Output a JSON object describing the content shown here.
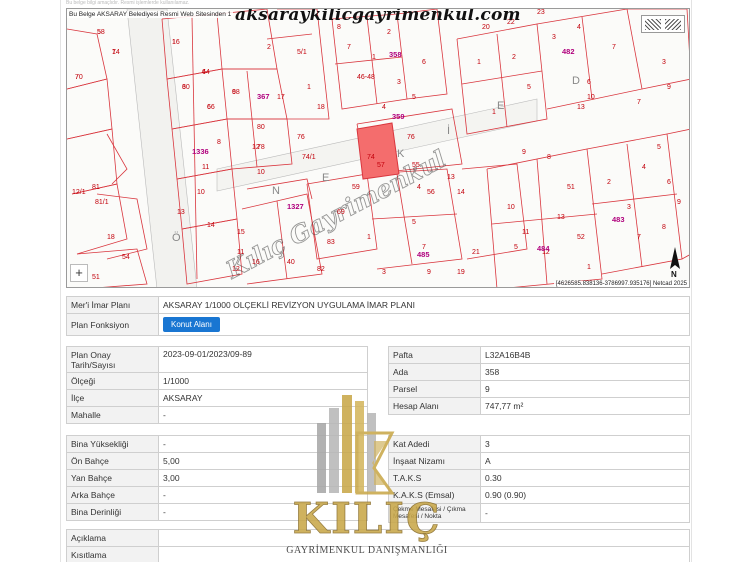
{
  "page": {
    "top_note": "Bu belge bilgi amaçlıdır. Resmi işlemlerde kullanılamaz."
  },
  "map": {
    "source_text": "Bu Belge AKSARAY Belediyesi Resmi Web Sitesinden 1",
    "watermark_url": "aksaraykilicgayrimenkul.com",
    "coords_text": "[4626585.838136-3786997.935176] Netcad 2025",
    "zoom_in_symbol": "+",
    "north_label": "N",
    "street_letters": [
      "Ö",
      "N",
      "E",
      "K",
      "İ",
      "E",
      "D"
    ],
    "diagonal_watermark": "Kılıç Gayrimenkul",
    "highlight_color": "#f46d6d",
    "block_numbers": [
      "367",
      "1336",
      "358",
      "1327",
      "483",
      "484",
      "485",
      "482",
      "359"
    ],
    "parcel_numbers": [
      "7",
      "5",
      "7",
      "1",
      "3",
      "4",
      "6",
      "9",
      "8",
      "11",
      "12",
      "10",
      "13",
      "14",
      "15",
      "16",
      "2",
      "5/1",
      "1",
      "17",
      "18",
      "80",
      "76",
      "78",
      "74/1",
      "74",
      "76",
      "57",
      "55",
      "56",
      "13",
      "14",
      "12/1",
      "81",
      "81/1",
      "18",
      "54",
      "51",
      "46-48",
      "1",
      "2",
      "3",
      "4",
      "5",
      "6",
      "7",
      "8",
      "10",
      "11",
      "12",
      "40",
      "82",
      "83",
      "69",
      "59",
      "1",
      "3",
      "4",
      "5",
      "7",
      "9",
      "19",
      "21",
      "20",
      "22",
      "23",
      "1",
      "2",
      "3",
      "4",
      "5",
      "6",
      "7",
      "8",
      "9",
      "10",
      "11",
      "12",
      "13",
      "51",
      "52",
      "1",
      "2",
      "3",
      "4",
      "5",
      "6",
      "7",
      "8",
      "9",
      "1",
      "3",
      "5",
      "7",
      "9",
      "10",
      "13",
      "70",
      "58",
      "14",
      "16",
      "60",
      "64",
      "66",
      "68"
    ]
  },
  "fields": {
    "meri_imar_plani": {
      "label": "Mer'i İmar Planı",
      "value": "AKSARAY 1/1000 OLÇEKLİ REVİZYON UYGULAMA İMAR PLANI"
    },
    "plan_fonksiyon": {
      "label": "Plan Fonksiyon",
      "button": "Konut Alanı"
    },
    "plan_onay": {
      "label": "Plan Onay Tarih/Sayısı",
      "value": "2023-09-01/2023/09-89"
    },
    "olcegi": {
      "label": "Ölçeği",
      "value": "1/1000"
    },
    "ilce": {
      "label": "İlçe",
      "value": "AKSARAY"
    },
    "mahalle": {
      "label": "Mahalle",
      "value": "-"
    },
    "pafta": {
      "label": "Pafta",
      "value": "L32A16B4B"
    },
    "ada": {
      "label": "Ada",
      "value": "358"
    },
    "parsel": {
      "label": "Parsel",
      "value": "9"
    },
    "hesap_alani": {
      "label": "Hesap Alanı",
      "value": "747,77 m²"
    },
    "bina_yuksekligi": {
      "label": "Bina Yüksekliği",
      "value": "-"
    },
    "on_bahce": {
      "label": "Ön Bahçe",
      "value": "5,00"
    },
    "yan_bahce": {
      "label": "Yan Bahçe",
      "value": "3,00"
    },
    "arka_bahce": {
      "label": "Arka Bahçe",
      "value": "-"
    },
    "bina_derinligi": {
      "label": "Bina Derinliği",
      "value": "-"
    },
    "kat_adedi": {
      "label": "Kat Adedi",
      "value": "3"
    },
    "insaat_nizami": {
      "label": "İnşaat Nizamı",
      "value": "A"
    },
    "taks": {
      "label": "T.A.K.S",
      "value": "0.30"
    },
    "kaks": {
      "label": "K.A.K.S (Emsal)",
      "value": "0.90 (0.90)"
    },
    "cekme_mesafesi": {
      "label": "Çekme Mesafesi / Çıkma Mesafesi / Nokta",
      "value": "-"
    },
    "aciklama": {
      "label": "Açıklama",
      "value": ""
    },
    "kisitlama": {
      "label": "Kısıtlama",
      "value": ""
    }
  },
  "logo": {
    "brand": "KILIÇ",
    "tagline": "GAYRİMENKUL DANIŞMANLIĞI",
    "gold": "#c9a84a",
    "silver": "#a8a8a8"
  },
  "colors": {
    "button_blue": "#1976d2",
    "label_bg": "#f2f2f2",
    "block_label": "#b0007d",
    "parcel_label": "#c2000b"
  }
}
